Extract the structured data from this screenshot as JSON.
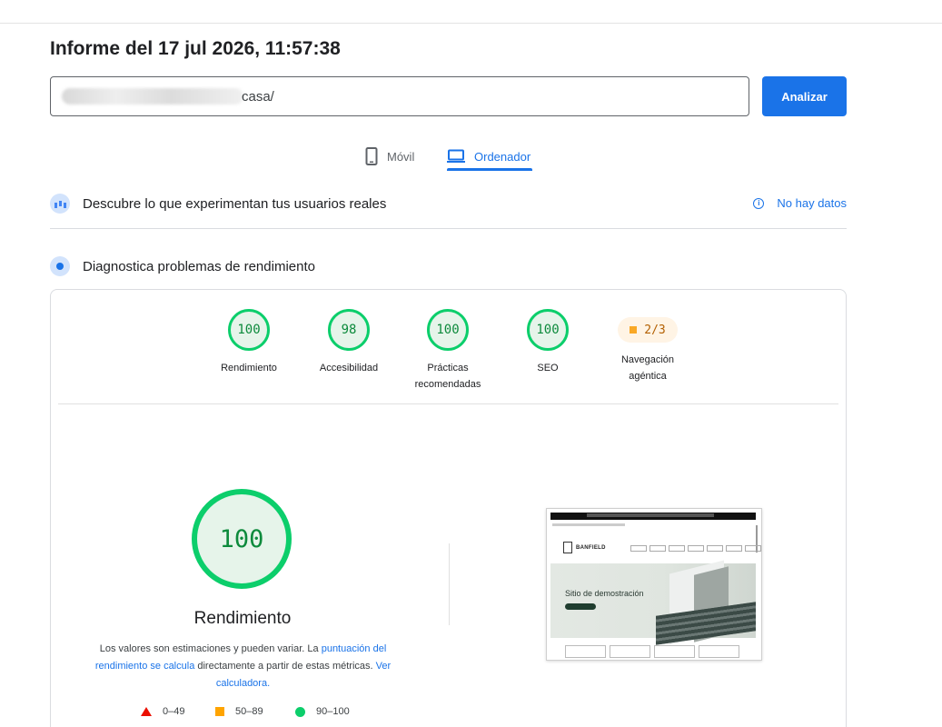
{
  "report": {
    "title": "Informe del 17 jul 2026, 11:57:38"
  },
  "search": {
    "url_visible": "casa/",
    "analyze_label": "Analizar"
  },
  "tabs": [
    {
      "label": "Móvil",
      "icon": "phone-icon",
      "active": false
    },
    {
      "label": "Ordenador",
      "icon": "laptop-icon",
      "active": true
    }
  ],
  "field_data": {
    "title": "Descubre lo que experimentan tus usuarios reales",
    "no_data_label": "No hay datos"
  },
  "diagnostics": {
    "title": "Diagnostica problemas de rendimiento"
  },
  "scores": [
    {
      "label": "Rendimiento",
      "value": "100"
    },
    {
      "label": "Accesibilidad",
      "value": "98"
    },
    {
      "label_line1": "Prácticas",
      "label_line2": "recomendadas",
      "value": "100"
    },
    {
      "label": "SEO",
      "value": "100"
    },
    {
      "label_line1": "Navegación",
      "label_line2": "agéntica",
      "value": "2/3"
    }
  ],
  "performance": {
    "score": "100",
    "label": "Rendimiento",
    "desc_part1": "Los valores son estimaciones y pueden variar. La ",
    "desc_link1": "puntuación del rendimiento se calcula",
    "desc_part2": " directamente a partir de estas métricas. ",
    "desc_link2": "Ver calculadora.",
    "legend": [
      {
        "range": "0–49",
        "color": "#eb0f00"
      },
      {
        "range": "50–89",
        "color": "#ffa400"
      },
      {
        "range": "90–100",
        "color": "#0cce6b"
      }
    ]
  },
  "screenshot": {
    "brand": "BANFIELD",
    "hero_title": "Sitio de demostración"
  },
  "colors": {
    "accent": "#1a73e8",
    "pass": "#0cce6b",
    "average": "#ffa400",
    "fail": "#eb0f00"
  }
}
